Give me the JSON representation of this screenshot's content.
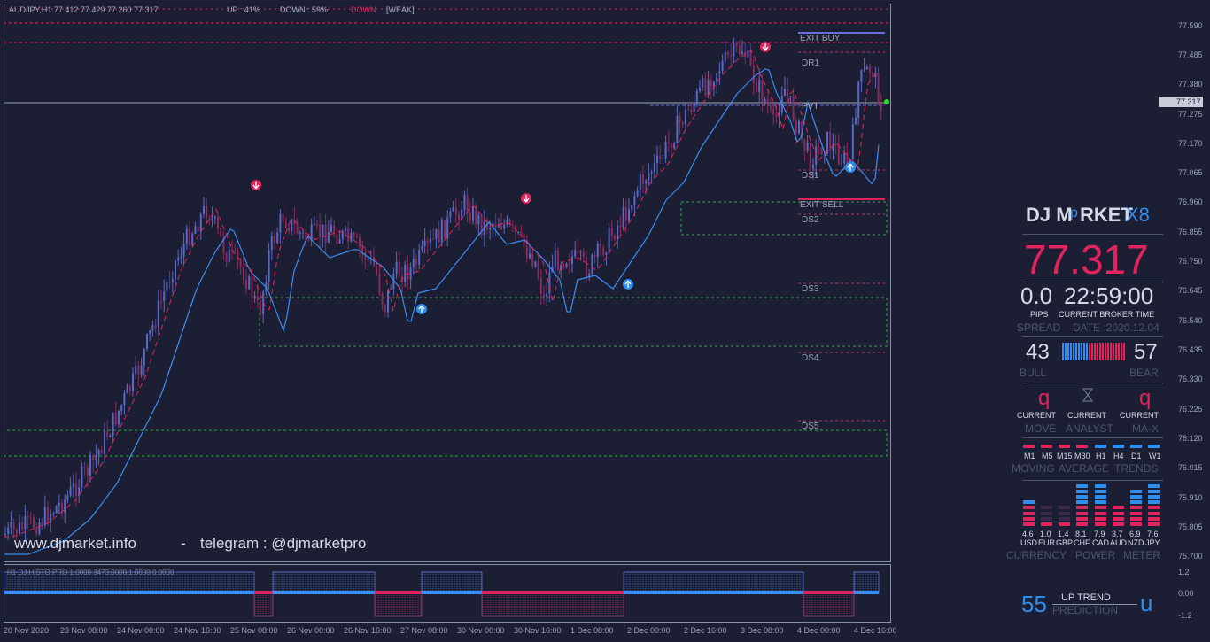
{
  "chart_title": "AUDJPY,H1  77.412 77.429 77.260 77.317",
  "status": {
    "up": "UP : 41%",
    "down": "DOWN : 59%",
    "dir": "DOWN",
    "strength": "[WEAK]"
  },
  "levels": {
    "exit_buy": "EXIT BUY",
    "dr1": "DR1",
    "pvt": "PVT",
    "ds1": "DS1",
    "exit_sell": "EXIT SELL",
    "ds2": "DS2",
    "ds3": "DS3",
    "ds4": "DS4",
    "ds5": "DS5"
  },
  "watermark": {
    "site": "www.djmarket.info",
    "sep": "-",
    "telegram": "telegram :  @djmarketpro"
  },
  "price_axis": [
    "77.590",
    "77.485",
    "77.380",
    "77.317",
    "77.275",
    "77.170",
    "77.065",
    "76.960",
    "76.855",
    "76.750",
    "76.645",
    "76.540",
    "76.435",
    "76.330",
    "76.225",
    "76.120",
    "76.015",
    "75.910",
    "75.805",
    "75.700"
  ],
  "indicator": {
    "title": "H1 DJ HISTO PRO 1.0000 3473.0000 1.0000 0.0000",
    "axis": [
      "1.2",
      "0.00",
      "-1.2"
    ]
  },
  "time_axis": [
    "20 Nov 2020",
    "23 Nov 08:00",
    "24 Nov 00:00",
    "24 Nov 16:00",
    "25 Nov 08:00",
    "26 Nov 00:00",
    "26 Nov 16:00",
    "27 Nov 08:00",
    "30 Nov 00:00",
    "30 Nov 16:00",
    "1 Dec 08:00",
    "2 Dec 00:00",
    "2 Dec 16:00",
    "3 Dec 08:00",
    "4 Dec 00:00",
    "4 Dec 16:00"
  ],
  "panel": {
    "brand_left": "DJ M",
    "brand_p": "p",
    "brand_mid": "RKET",
    "brand_x8": "X8",
    "price": "77.317",
    "pips_value": "0.0",
    "time_value": "22:59:00",
    "pips_label": "PIPS",
    "time_label": "CURRENT BROKER TIME",
    "spread_label": "SPREAD",
    "date_label": "DATE :2020.12.04",
    "bull_value": "43",
    "bear_value": "57",
    "bull_label": "BULL",
    "bear_label": "BEAR",
    "move_icon": "q",
    "analyst_icon": "hourglass-icon",
    "max_icon": "q",
    "current1": "CURRENT",
    "current2": "CURRENT",
    "current3": "CURRENT",
    "move_label": "MOVE",
    "analyst_label": "ANALYST",
    "max_label": "MA-X",
    "tfs": [
      "M1",
      "M5",
      "M15",
      "M30",
      "H1",
      "H4",
      "D1",
      "W1"
    ],
    "tf_colors": [
      "#e0245e",
      "#e0245e",
      "#e0245e",
      "#e0245e",
      "#2e8ef0",
      "#2e8ef0",
      "#2e8ef0",
      "#2e8ef0"
    ],
    "ma_w1": "MOVING",
    "ma_w2": "AVERAGE",
    "ma_w3": "TRENDS",
    "currency_values": [
      "4.6",
      "1.0",
      "1.4",
      "8.1",
      "7.9",
      "3.7",
      "6.9",
      "7.6"
    ],
    "currency_names": [
      "USD",
      "EUR",
      "GBP",
      "CHF",
      "CAD",
      "AUD",
      "NZD",
      "JPY"
    ],
    "cp_w1": "CURRENCY",
    "cp_w2": "POWER",
    "cp_w3": "METER",
    "pred_value": "55",
    "pred_top": "UP TREND",
    "pred_bottom": "PREDICTION",
    "pred_icon": "u"
  },
  "colors": {
    "bg": "#1c1f33",
    "bull": "#2e8ef0",
    "bear": "#e0245e",
    "grid": "#4d5470"
  }
}
